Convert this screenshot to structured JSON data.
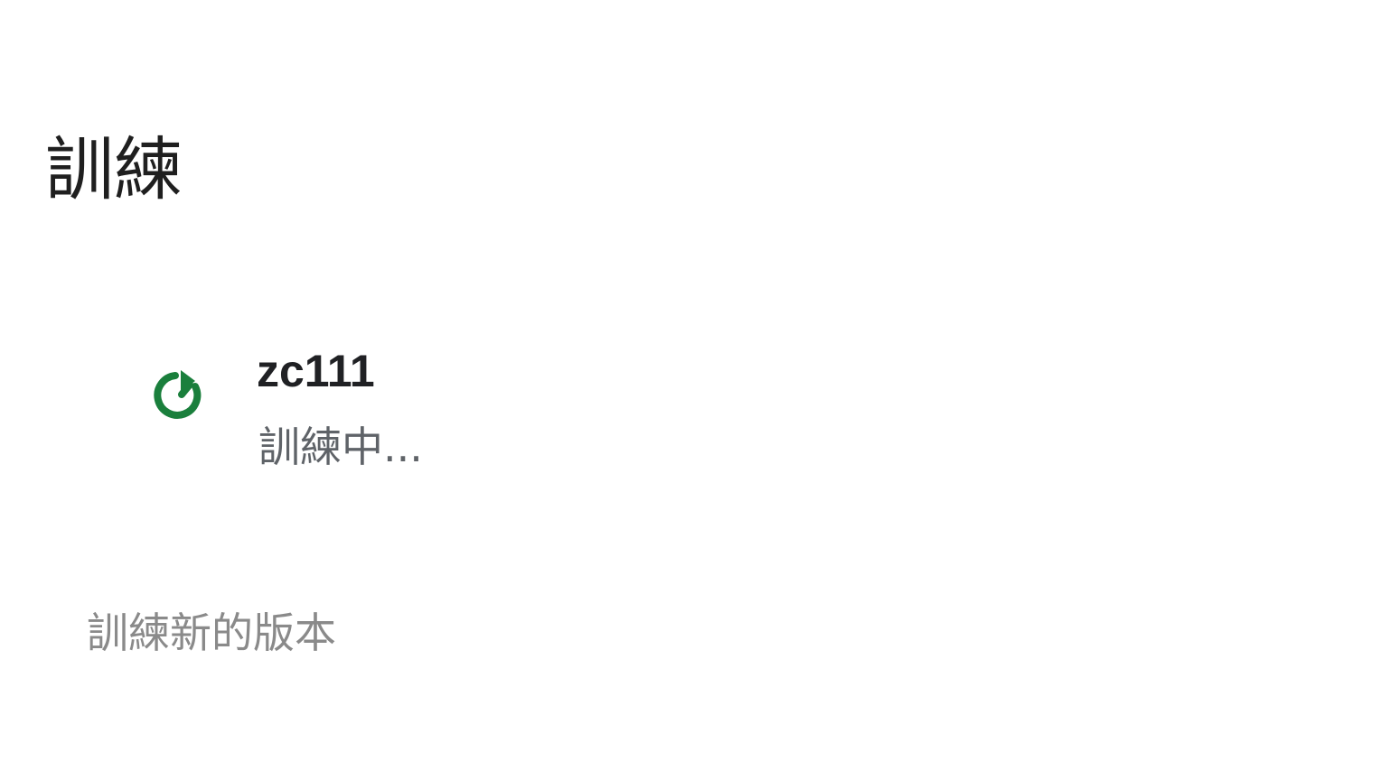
{
  "page": {
    "title": "訓練"
  },
  "training_item": {
    "name": "zc111",
    "status": "訓練中...",
    "status_icon": "refresh-icon",
    "status_color": "#1a7f3c"
  },
  "actions": {
    "train_new_label": "訓練新的版本"
  }
}
